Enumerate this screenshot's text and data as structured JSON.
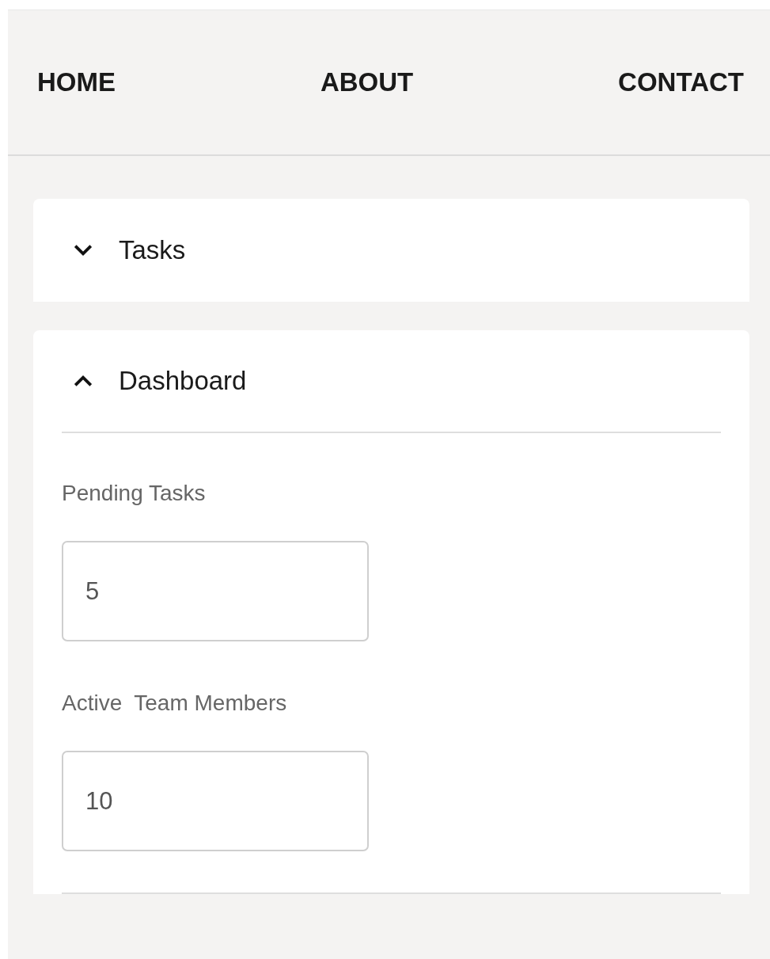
{
  "nav": [
    {
      "label": "HOME"
    },
    {
      "label": "ABOUT"
    },
    {
      "label": "CONTACT"
    }
  ],
  "sections": [
    {
      "title": "Tasks",
      "expanded": false
    },
    {
      "title": "Dashboard",
      "expanded": true,
      "fields": [
        {
          "label": "Pending Tasks",
          "value": "5"
        },
        {
          "label": "Active  Team Members",
          "value": "10"
        }
      ]
    }
  ]
}
